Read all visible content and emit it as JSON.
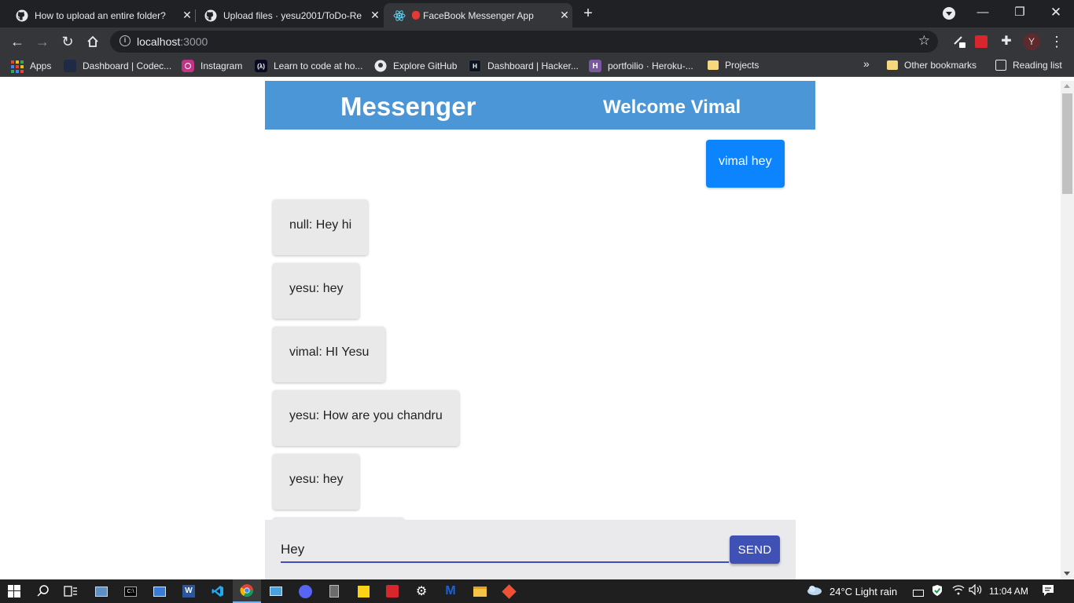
{
  "browser": {
    "tabs": [
      {
        "title": "How to upload an entire folder?",
        "active": false
      },
      {
        "title": "Upload files · yesu2001/ToDo-Re",
        "active": false
      },
      {
        "title": "FaceBook Messenger App",
        "active": true
      }
    ],
    "url_host": "localhost",
    "url_port": ":3000",
    "profile_initial": "Y"
  },
  "bookmarks": {
    "items": [
      {
        "label": "Apps",
        "icon": "apps-grid-icon"
      },
      {
        "label": "Dashboard | Codec...",
        "icon": "codecademy-icon"
      },
      {
        "label": "Instagram",
        "icon": "instagram-icon"
      },
      {
        "label": "Learn to code at ho...",
        "icon": "freecodecamp-icon"
      },
      {
        "label": "Explore GitHub",
        "icon": "github-icon"
      },
      {
        "label": "Dashboard | Hacker...",
        "icon": "hackerrank-icon"
      },
      {
        "label": "portfoilio · Heroku-...",
        "icon": "heroku-icon"
      },
      {
        "label": "Projects",
        "icon": "folder-icon"
      }
    ],
    "overflow": "»",
    "other_bookmarks": "Other bookmarks",
    "reading_list": "Reading list"
  },
  "app": {
    "title": "Messenger",
    "welcome": "Welcome Vimal",
    "own_messages": [
      "vimal hey"
    ],
    "messages": [
      "null: Hey hi",
      "yesu: hey",
      "vimal: HI Yesu",
      "yesu: How are you chandru",
      "yesu: hey"
    ],
    "input_value": "Hey",
    "send_label": "SEND"
  },
  "colors": {
    "header_bg": "#4a96d6",
    "own_bubble": "#0b84fe",
    "other_bubble": "#e9e9e9",
    "send_button": "#3f51b5"
  },
  "taskbar": {
    "weather": "24°C  Light rain",
    "time": "11:04 AM"
  }
}
